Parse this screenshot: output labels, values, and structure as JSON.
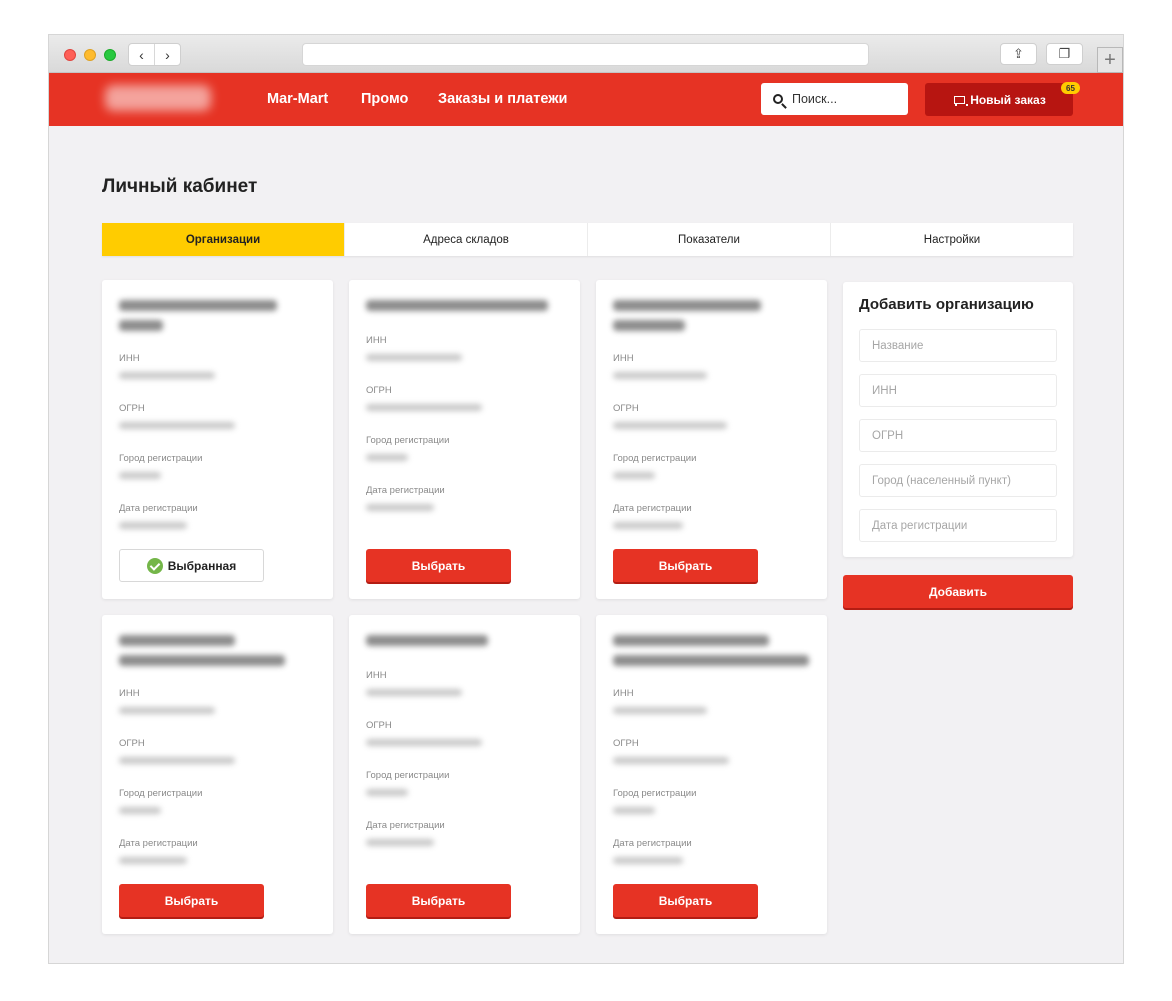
{
  "header": {
    "nav": [
      "Mar-Mart",
      "Промо",
      "Заказы и платежи"
    ],
    "search_placeholder": "Поиск...",
    "new_order_label": "Новый заказ",
    "cart_count": "65",
    "brand_color": "#e63324"
  },
  "page": {
    "title": "Личный кабинет",
    "tabs": [
      "Организации",
      "Адреса складов",
      "Показатели",
      "Настройки"
    ],
    "active_tab": "Организации"
  },
  "organizations": {
    "field_labels": {
      "inn": "ИНН",
      "ogrn": "ОГРН",
      "city": "Город регистрации",
      "date": "Дата регистрации"
    },
    "select_label": "Выбрать",
    "selected_label": "Выбранная",
    "cards": [
      {
        "selected": true
      },
      {
        "selected": false
      },
      {
        "selected": false
      },
      {
        "selected": false
      },
      {
        "selected": false
      },
      {
        "selected": false
      }
    ]
  },
  "add_form": {
    "title": "Добавить организацию",
    "placeholders": {
      "name": "Название",
      "inn": "ИНН",
      "ogrn": "ОГРН",
      "city": "Город (населенный пункт)",
      "date": "Дата регистрации"
    },
    "submit_label": "Добавить"
  }
}
